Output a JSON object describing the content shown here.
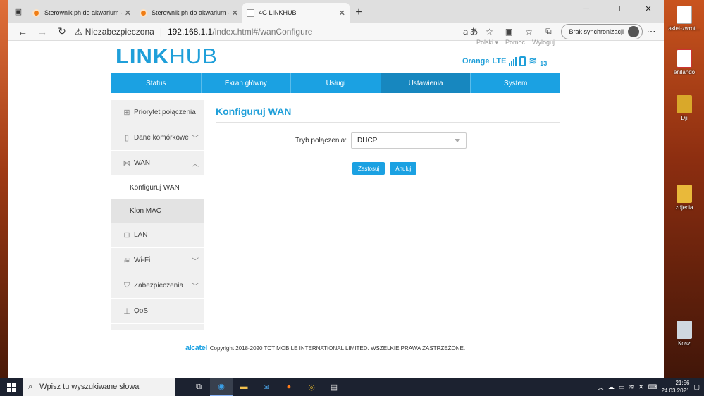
{
  "browser": {
    "tabs": [
      {
        "title": "Sterownik ph do akwarium – Stro",
        "active": false
      },
      {
        "title": "Sterownik ph do akwarium – Stro",
        "active": false
      },
      {
        "title": "4G LINKHUB",
        "active": true
      }
    ],
    "security_label": "Niezabezpieczona",
    "url_host": "192.168.1.1",
    "url_path": "/index.html#/wanConfigure",
    "sync_label": "Brak synchronizacji"
  },
  "router": {
    "logo_bold": "LINK",
    "logo_light": "HUB",
    "top_links": {
      "language": "Polski",
      "help": "Pomoc",
      "logout": "Wyloguj"
    },
    "status": {
      "operator": "Orange",
      "network": "LTE",
      "wifi_clients": "13"
    },
    "nav": [
      {
        "label": "Status",
        "active": false
      },
      {
        "label": "Ekran główny",
        "active": false
      },
      {
        "label": "Usługi",
        "active": false
      },
      {
        "label": "Ustawienia",
        "active": true
      },
      {
        "label": "System",
        "active": false
      }
    ],
    "sidebar": {
      "priority": "Priorytet połączenia",
      "mobile": "Dane komórkowe",
      "wan": "WAN",
      "wan_config": "Konfiguruj WAN",
      "mac_clone": "Klon MAC",
      "lan": "LAN",
      "wifi": "Wi-Fi",
      "security": "Zabezpieczenia",
      "qos": "QoS"
    },
    "page_title": "Konfiguruj WAN",
    "form": {
      "mode_label": "Tryb połączenia:",
      "mode_value": "DHCP",
      "apply": "Zastosuj",
      "cancel": "Anuluj"
    },
    "footer": {
      "brand": "alcatel",
      "copyright": "Copyright 2018-2020 TCT MOBILE INTERNATIONAL LIMITED. WSZELKIE PRAWA ZASTRZEŻONE."
    }
  },
  "desktop": {
    "icons": [
      "akiet-zwrot...",
      "enilando",
      "Dji",
      "zdjecia",
      "Kosz"
    ]
  },
  "taskbar": {
    "search_placeholder": "Wpisz tu wyszukiwane słowa",
    "time": "21:56",
    "date": "24.03.2021"
  }
}
